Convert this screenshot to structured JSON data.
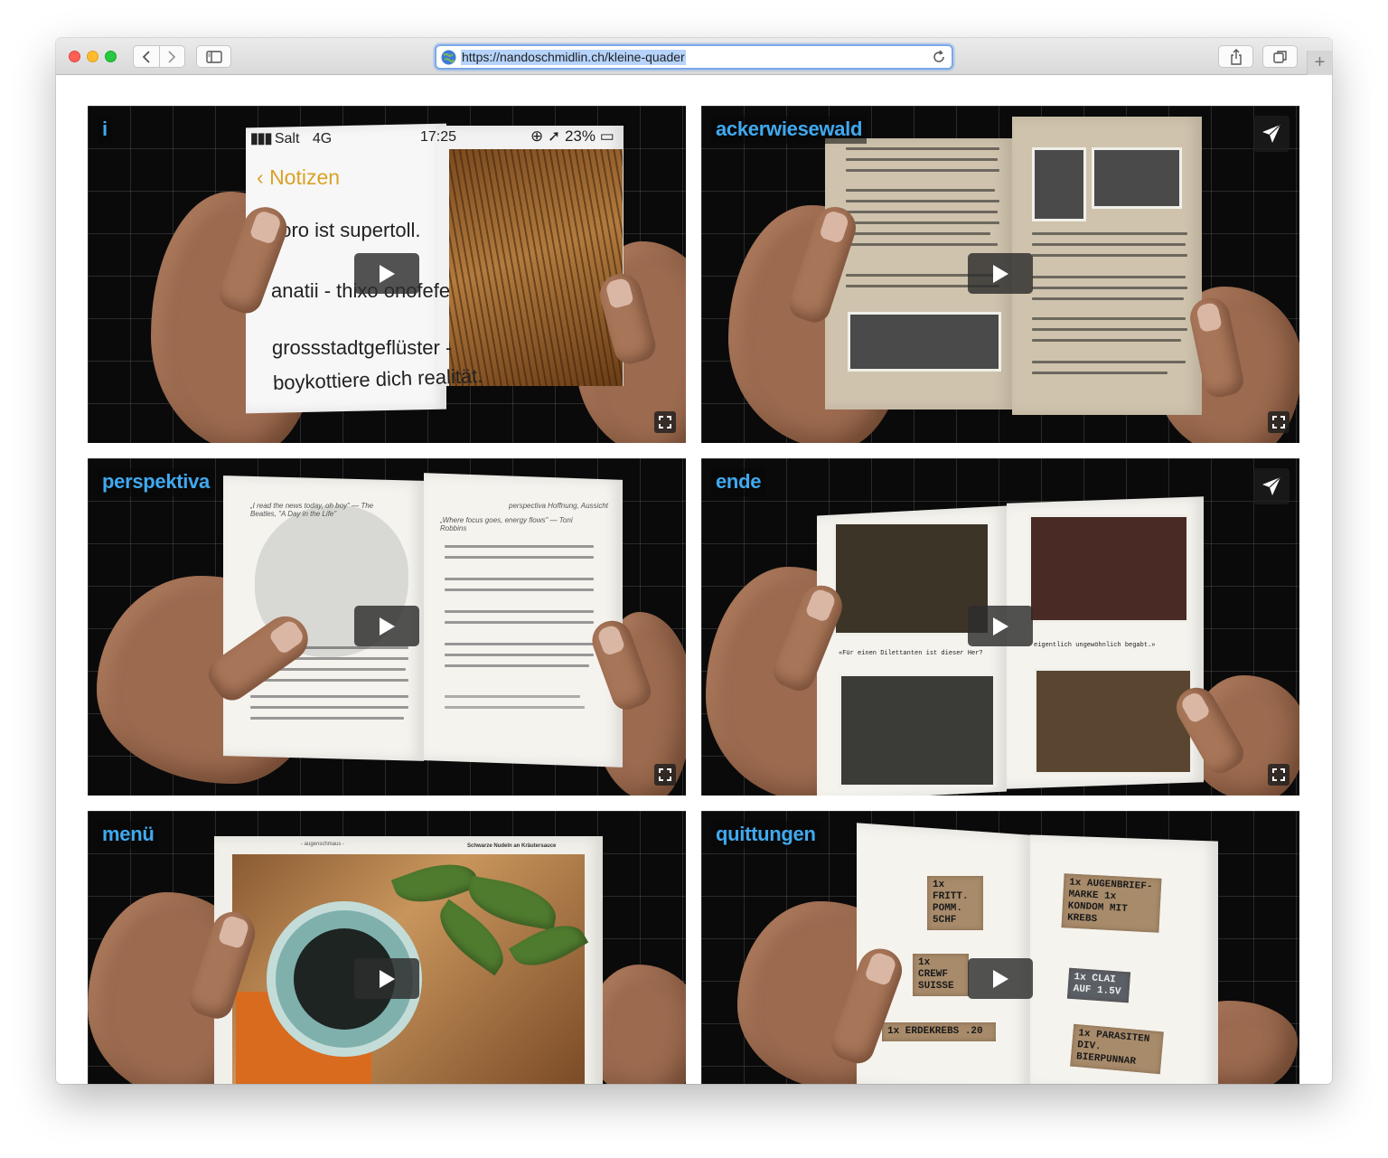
{
  "browser": {
    "url": "https://nandoschmidlin.ch/kleine-quader"
  },
  "videos": [
    {
      "label": "i",
      "has_share": false
    },
    {
      "label": "ackerwiesewald",
      "has_share": true
    },
    {
      "label": "perspektiva",
      "has_share": false
    },
    {
      "label": "ende",
      "has_share": true
    },
    {
      "label": "menü",
      "has_share": false
    },
    {
      "label": "quittungen",
      "has_share": false
    }
  ],
  "tile_i": {
    "status_carrier": "Salt",
    "status_network": "4G",
    "status_time": "17:25",
    "status_battery": "23%",
    "back_label": "Notizen",
    "notes": [
      "doro ist supertoll.",
      "anatii - thixo onofefe",
      "grossstadtgeflüster -",
      "boykottiere dich realität."
    ]
  },
  "tile_perspektiva": {
    "quote_left": "„I read the news today, oh boy\" — The Beatles, \"A Day in the Life\"",
    "quote_right": "„Where focus goes, energy flows\" — Toni Robbins",
    "header_right": "perspectiva Hoffnung, Aussicht"
  },
  "tile_ende": {
    "caption_left": "«Für einen Dilettanten ist dieser Her?",
    "caption_right": "eigentlich ungewöhnlich begabt.»"
  },
  "tile_quittungen": {
    "receipts": [
      "1x FRITT. POMM. 5CHF",
      "1x AUGENBRIEF-MARKE 1x KONDOM MIT KREBS",
      "1x CREWF SUISSE",
      "1x CLAI AUF 1.5V",
      "1x ERDEKREBS .20",
      "1x PARASITEN DIV. BIERPUNNAR"
    ]
  },
  "tile_menu": {
    "header_left": "- augenschmaus -",
    "header_right": "Schwarze Nudeln an Kräutersauce"
  },
  "colors": {
    "label_blue": "#40a9ef",
    "tile_bg": "#0a0a0a",
    "url_highlight": "#b5d3fb"
  },
  "icons": {
    "play": "play-icon",
    "fullscreen": "fullscreen-icon",
    "share": "paper-plane-icon"
  }
}
